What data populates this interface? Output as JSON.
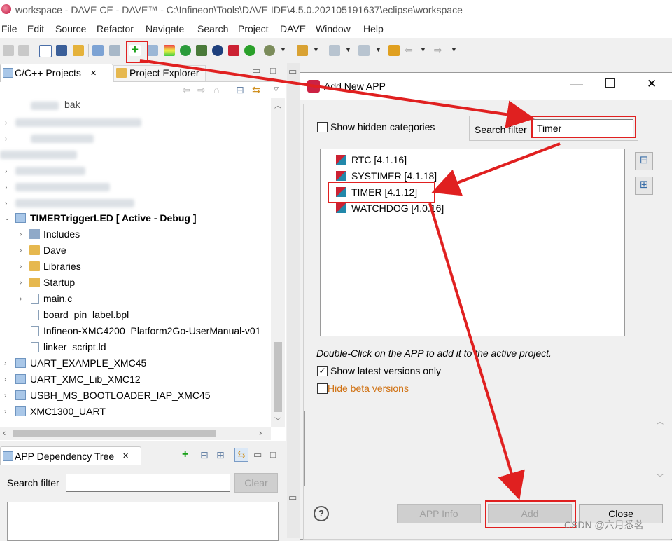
{
  "window": {
    "title": "workspace - DAVE CE - DAVE™ - C:\\Infineon\\Tools\\DAVE IDE\\4.5.0.202105191637\\eclipse\\workspace"
  },
  "menu": [
    "File",
    "Edit",
    "Source",
    "Refactor",
    "Navigate",
    "Search",
    "Project",
    "DAVE",
    "Window",
    "Help"
  ],
  "left_tabs": {
    "active": "C/C++ Projects",
    "inactive": "Project Explorer"
  },
  "tree": {
    "blurred_top": "bak",
    "active_project": "TIMERTriggerLED [ Active - Debug ]",
    "children": [
      "Includes",
      "Dave",
      "Libraries",
      "Startup",
      "main.c",
      "board_pin_label.bpl",
      "Infineon-XMC4200_Platform2Go-UserManual-v01",
      "linker_script.ld"
    ],
    "projects": [
      "UART_EXAMPLE_XMC45",
      "UART_XMC_Lib_XMC12",
      "USBH_MS_BOOTLOADER_IAP_XMC45",
      "XMC1300_UART"
    ]
  },
  "dependency": {
    "tab_label": "APP Dependency Tree",
    "search_label": "Search filter",
    "search_value": "",
    "clear_label": "Clear"
  },
  "dialog": {
    "title": "Add New APP",
    "show_hidden_label": "Show hidden categories",
    "search_label": "Search filter",
    "search_value": "Timer",
    "apps": [
      "RTC [4.1.16]",
      "SYSTIMER [4.1.18]",
      "TIMER [4.1.12]",
      "WATCHDOG [4.0.16]"
    ],
    "hint": "Double-Click on the APP to add it to the active project.",
    "latest_label": "Show latest versions only",
    "beta_label": "Hide beta versions",
    "app_info_label": "APP Info",
    "add_label": "Add",
    "close_label": "Close"
  },
  "watermark": "CSDN @六月悉茗",
  "colors": {
    "highlight": "#e02020",
    "link": "#d07010",
    "folder": "#e6b84f"
  }
}
